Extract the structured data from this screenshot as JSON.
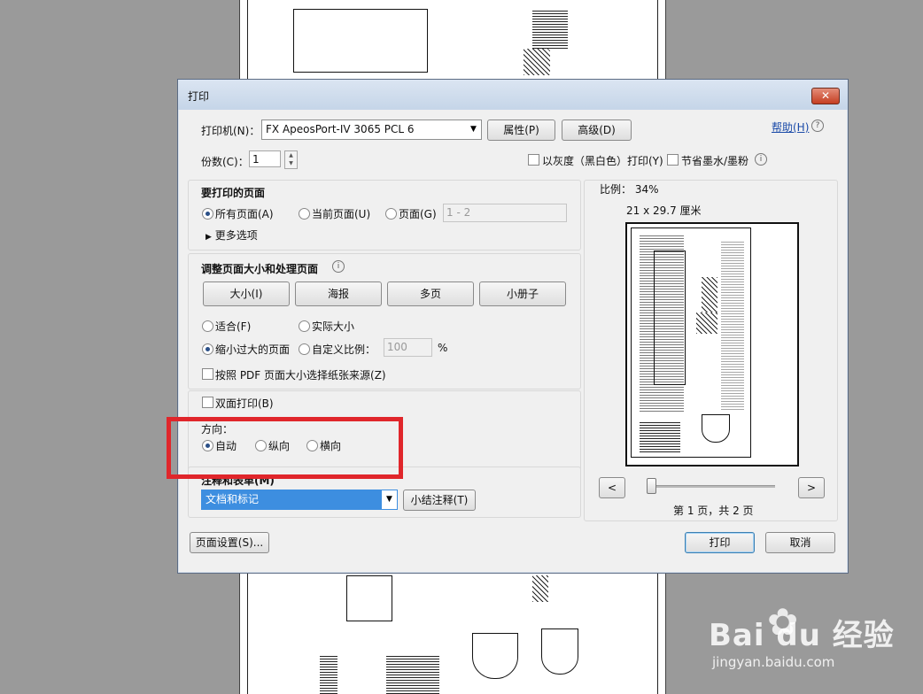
{
  "dialog": {
    "title": "打印",
    "close_label": "✕",
    "printer_label": "打印机(N)：",
    "printer_value": "FX ApeosPort-IV 3065 PCL 6",
    "properties_button": "属性(P)",
    "advanced_button": "高级(D)",
    "help_link": "帮助(H)",
    "copies_label": "份数(C)：",
    "copies_value": "1",
    "grayscale_label": "以灰度（黑白色）打印(Y)",
    "save_ink_label": "节省墨水/墨粉",
    "pages_section": {
      "title": "要打印的页面",
      "all_pages": "所有页面(A)",
      "current_page": "当前页面(U)",
      "pages": "页面(G)",
      "pages_range": "1 - 2",
      "more_options": "更多选项"
    },
    "sizing_section": {
      "title": "调整页面大小和处理页面",
      "size_button": "大小(I)",
      "poster_button": "海报",
      "multiple_button": "多页",
      "booklet_button": "小册子",
      "fit": "适合(F)",
      "actual_size": "实际大小",
      "shrink": "缩小过大的页面",
      "custom_scale": "自定义比例：",
      "custom_scale_value": "100",
      "percent": "%",
      "paper_source": "按照 PDF 页面大小选择纸张来源(Z)"
    },
    "duplex_label": "双面打印(B)",
    "orientation": {
      "title": "方向：",
      "auto": "自动",
      "portrait": "纵向",
      "landscape": "横向"
    },
    "comments": {
      "title": "注释和表单(M)",
      "value": "文档和标记",
      "summarize_button": "小结注释(T)"
    },
    "preview": {
      "scale": "比例：  34%",
      "size": "21 x 29.7 厘米",
      "prev": "<",
      "next": ">",
      "page_info": "第 1 页，共 2 页",
      "slider_position": 0
    },
    "page_setup_button": "页面设置(S)...",
    "print_button": "打印",
    "cancel_button": "取消"
  },
  "watermark": {
    "logo": "Bai du 经验",
    "url": "jingyan.baidu.com"
  },
  "colors": {
    "highlight": "#e0262b",
    "selection": "#3d8ee0"
  }
}
